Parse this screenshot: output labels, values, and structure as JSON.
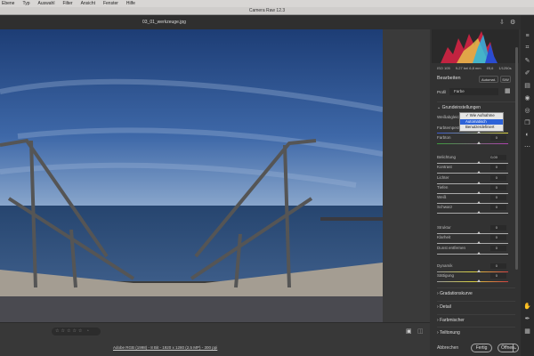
{
  "menu": [
    "Ebene",
    "Typ",
    "Auswahl",
    "Filter",
    "Ansicht",
    "Fenster",
    "Hilfe"
  ],
  "app_title": "Camera Raw 12.3",
  "file_name": "03_01_werkzeuge.jpg",
  "exif": {
    "iso": "ISO 105",
    "lens": "9-27 bei 6,8 mm",
    "aperture": "f/5,6",
    "shutter": "1/1250s"
  },
  "edit": {
    "title": "Bearbeiten",
    "auto": "Automat.",
    "bw": "S/W",
    "profile_label": "Profil",
    "profile_value": "Farbe"
  },
  "basic": {
    "title": "Grundeinstellungen",
    "wb_label": "Weißabgleich",
    "temp_label": "Farbtemperatur",
    "tint_label": "Farbton",
    "tint_value": "0"
  },
  "wb_popup": {
    "options": [
      "Wie Aufnahme",
      "Automatisch",
      "Benutzerdefiniert"
    ],
    "checked": "Wie Aufnahme",
    "highlighted": "Automatisch"
  },
  "sliders": [
    {
      "label": "Belichtung",
      "value": "0,00"
    },
    {
      "label": "Kontrast",
      "value": "0"
    },
    {
      "label": "Lichter",
      "value": "0"
    },
    {
      "label": "Tiefen",
      "value": "0"
    },
    {
      "label": "Weiß",
      "value": "0"
    },
    {
      "label": "Schwarz",
      "value": "0"
    },
    {
      "label": "Struktur",
      "value": "0"
    },
    {
      "label": "Klarheit",
      "value": "0"
    },
    {
      "label": "Dunst entfernen",
      "value": "0"
    },
    {
      "label": "Dynamik",
      "value": "0"
    },
    {
      "label": "Sättigung",
      "value": "0"
    }
  ],
  "sections": [
    "Gradationskurve",
    "Detail",
    "Farbmischer",
    "Teiltonung"
  ],
  "footer": {
    "file_info": "Adobe RGB (1998) - 8 Bit - 1920 x 1280 (2,5 MP) - 300 ppi",
    "cancel": "Abbrechen",
    "done": "Fertig",
    "open": "Öffnen"
  },
  "rating_stars": "☆☆☆☆☆"
}
